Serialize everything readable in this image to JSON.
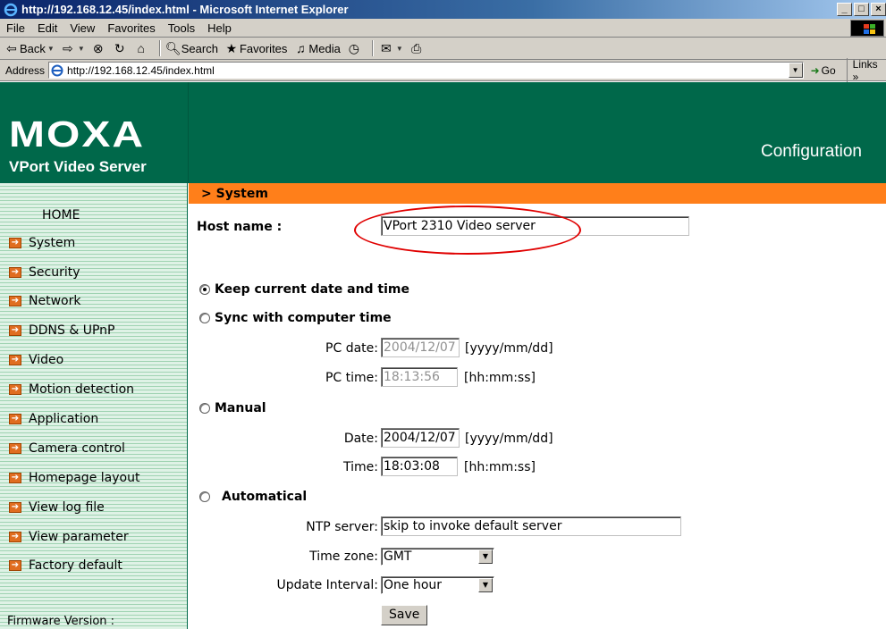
{
  "browser": {
    "title": "http://192.168.12.45/index.html - Microsoft Internet Explorer",
    "menu": [
      "File",
      "Edit",
      "View",
      "Favorites",
      "Tools",
      "Help"
    ],
    "toolbar": {
      "back": "Back",
      "search": "Search",
      "favorites": "Favorites",
      "media": "Media"
    },
    "address_label": "Address",
    "address_value": "http://192.168.12.45/index.html",
    "go_label": "Go",
    "links_label": "Links »"
  },
  "header": {
    "logo": "MOXA",
    "product": "VPort Video Server",
    "page": "Configuration"
  },
  "sidebar": {
    "home": "HOME",
    "items": [
      {
        "label": "System"
      },
      {
        "label": "Security"
      },
      {
        "label": "Network"
      },
      {
        "label": "DDNS & UPnP"
      },
      {
        "label": "Video"
      },
      {
        "label": "Motion detection"
      },
      {
        "label": "Application"
      },
      {
        "label": "Camera control"
      },
      {
        "label": "Homepage layout"
      },
      {
        "label": "View log file"
      },
      {
        "label": "View parameter"
      },
      {
        "label": "Factory default"
      }
    ],
    "firmware_label": "Firmware Version :"
  },
  "section": "> System",
  "form": {
    "host_label": "Host name :",
    "host_value": "VPort 2310 Video server",
    "keep_label": "Keep current date and time",
    "sync_label": "Sync with computer time",
    "pc_date_label": "PC date:",
    "pc_date_value": "2004/12/07",
    "pc_date_fmt": "[yyyy/mm/dd]",
    "pc_time_label": "PC time:",
    "pc_time_value": "18:13:56",
    "pc_time_fmt": "[hh:mm:ss]",
    "manual_label": "Manual",
    "date_label": "Date:",
    "date_value": "2004/12/07",
    "date_fmt": "[yyyy/mm/dd]",
    "time_label": "Time:",
    "time_value": "18:03:08",
    "time_fmt": "[hh:mm:ss]",
    "auto_label": "Automatical",
    "ntp_label": "NTP server:",
    "ntp_value": "skip to invoke default server",
    "tz_label": "Time zone:",
    "tz_value": "GMT",
    "interval_label": "Update Interval:",
    "interval_value": "One hour",
    "save_label": "Save",
    "selected_mode": "keep"
  }
}
